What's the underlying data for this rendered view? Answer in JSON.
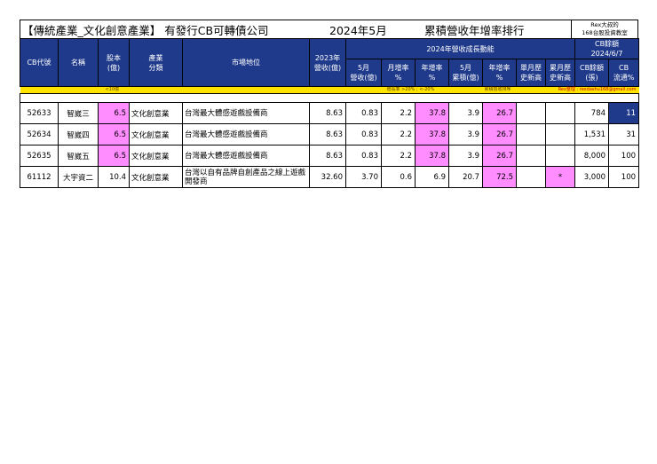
{
  "title": {
    "main": "【傳統產業_文化創意產業】 有發行CB可轉債公司",
    "month": "2024年5月",
    "ranking": "累積營收年增率排行",
    "brand_line1": "Rex大叔的",
    "brand_line2": "168台股投資教室"
  },
  "header": {
    "group_revenue": "2024年營收成長動能",
    "cb_group_1": "CB餘額",
    "cb_group_2": "2024/6/7",
    "columns": {
      "code": "CB代號",
      "name": "名稱",
      "capital_1": "股本",
      "capital_2": "(億)",
      "industry_1": "產業",
      "industry_2": "分類",
      "market": "市場地位",
      "rev2023_1": "2023年",
      "rev2023_2": "營收(億)",
      "m5rev_1": "5月",
      "m5rev_2": "營收(億)",
      "mom_1": "月增率",
      "mom_2": "%",
      "yoy_1": "年增率",
      "yoy_2": "%",
      "cum_1": "5月",
      "cum_2": "累積(億)",
      "cumyoy_1": "年增率",
      "cumyoy_2": "%",
      "hist_1": "單月歷",
      "hist_2": "史新高",
      "cumhist_1": "累月歷",
      "cumhist_2": "史新高",
      "cbbal_1": "CB餘額",
      "cbbal_2": "(張)",
      "cbflow_1": "CB",
      "cbflow_2": "流通%"
    }
  },
  "notes": {
    "capital": "<10億",
    "growth": "增長率 >20% ; <-20%",
    "cum_sort": "累積營收排序",
    "contact": "Rex整理 : rexdashu168@gmail.com"
  },
  "rows": [
    {
      "code": "52633",
      "name": "智崴三",
      "capital": "6.5",
      "industry": "文化創意業",
      "market": "台灣最大體感遊戲設備商",
      "rev2023": "8.63",
      "m5rev": "0.83",
      "mom": "2.2",
      "yoy": "37.8",
      "cum": "3.9",
      "cumyoy": "26.7",
      "hist": "",
      "cumhist": "",
      "cbbal": "784",
      "cbflow": "11"
    },
    {
      "code": "52634",
      "name": "智崴四",
      "capital": "6.5",
      "industry": "文化創意業",
      "market": "台灣最大體感遊戲設備商",
      "rev2023": "8.63",
      "m5rev": "0.83",
      "mom": "2.2",
      "yoy": "37.8",
      "cum": "3.9",
      "cumyoy": "26.7",
      "hist": "",
      "cumhist": "",
      "cbbal": "1,531",
      "cbflow": "31"
    },
    {
      "code": "52635",
      "name": "智崴五",
      "capital": "6.5",
      "industry": "文化創意業",
      "market": "台灣最大體感遊戲設備商",
      "rev2023": "8.63",
      "m5rev": "0.83",
      "mom": "2.2",
      "yoy": "37.8",
      "cum": "3.9",
      "cumyoy": "26.7",
      "hist": "",
      "cumhist": "",
      "cbbal": "8,000",
      "cbflow": "100"
    },
    {
      "code": "61112",
      "name": "大宇資二",
      "capital": "10.4",
      "industry": "文化創意業",
      "market": "台灣以自有品牌自創產品之線上遊戲開發商",
      "rev2023": "32.60",
      "m5rev": "3.70",
      "mom": "0.6",
      "yoy": "6.9",
      "cum": "20.7",
      "cumyoy": "72.5",
      "hist": "",
      "cumhist": "*",
      "cbbal": "3,000",
      "cbflow": "100"
    }
  ],
  "colors": {
    "header_bg": "#1f3a8a",
    "highlight_pink": "#ff8dff",
    "note_yellow": "#ffe400"
  }
}
